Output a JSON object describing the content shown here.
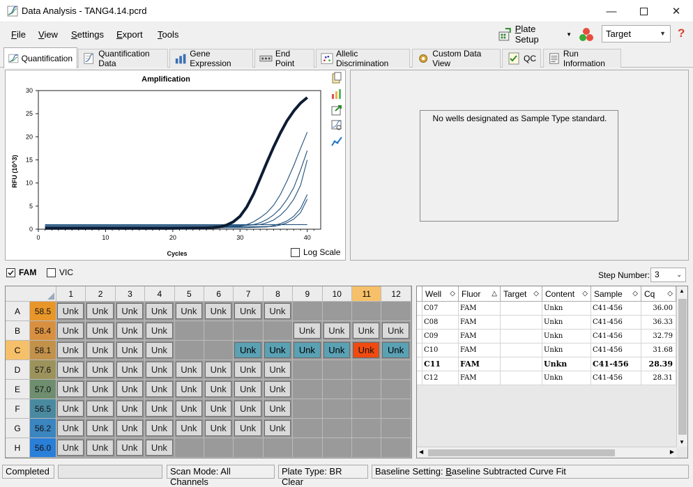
{
  "window": {
    "title": "Data Analysis - TANG4.14.pcrd"
  },
  "menu": [
    {
      "label": "File",
      "u": "F",
      "rest": "ile"
    },
    {
      "label": "View",
      "u": "V",
      "rest": "iew"
    },
    {
      "label": "Settings",
      "u": "S",
      "rest": "ettings"
    },
    {
      "label": "Export",
      "u": "E",
      "rest": "xport"
    },
    {
      "label": "Tools",
      "u": "T",
      "rest": "ools"
    }
  ],
  "toolbar": {
    "plate_setup_u": "P",
    "plate_setup_rest": "late Setup",
    "target_value": "Target",
    "help": "?"
  },
  "tabs": [
    "Quantification",
    "Quantification Data",
    "Gene Expression",
    "End Point",
    "Allelic Discrimination",
    "Custom Data View",
    "QC",
    "Run Information"
  ],
  "chart": {
    "title": "Amplification",
    "xlabel": "Cycles",
    "ylabel": "RFU (10^3)",
    "log_scale_label": "Log Scale"
  },
  "chart_data": {
    "type": "line",
    "title": "Amplification",
    "xlabel": "Cycles",
    "ylabel": "RFU (10^3)",
    "xlim": [
      0,
      42
    ],
    "ylim": [
      0,
      30
    ],
    "xticks": [
      0,
      10,
      20,
      30,
      40
    ],
    "yticks": [
      0,
      5,
      10,
      15,
      20,
      25,
      30
    ],
    "grid": true,
    "series": [
      {
        "x": [
          1,
          5,
          10,
          15,
          20,
          25,
          27,
          28,
          29,
          30,
          31,
          32,
          33,
          34,
          35,
          36,
          37,
          38,
          39,
          40
        ],
        "y": [
          0.2,
          0.2,
          0.2,
          0.2,
          0.2,
          0.3,
          0.5,
          0.9,
          1.6,
          2.8,
          4.8,
          7.6,
          11,
          14.5,
          17.8,
          20.8,
          23.5,
          25.6,
          27.3,
          28.5
        ],
        "highlight": true
      },
      {
        "x": [
          1,
          5,
          10,
          15,
          20,
          25,
          30,
          31,
          32,
          33,
          34,
          35,
          36,
          37,
          38,
          39,
          40
        ],
        "y": [
          0.4,
          0.4,
          0.4,
          0.4,
          0.4,
          0.4,
          0.6,
          1.0,
          1.6,
          2.5,
          3.6,
          5.2,
          7.5,
          10.5,
          13.8,
          17.5,
          21
        ]
      },
      {
        "x": [
          1,
          5,
          10,
          15,
          20,
          25,
          30,
          32,
          33,
          34,
          35,
          36,
          37,
          38,
          39,
          40
        ],
        "y": [
          0.6,
          0.6,
          0.6,
          0.6,
          0.6,
          0.6,
          0.7,
          1.0,
          1.4,
          2.1,
          3.1,
          4.5,
          6.5,
          9.0,
          12.8,
          17
        ]
      },
      {
        "x": [
          1,
          5,
          10,
          15,
          20,
          25,
          30,
          33,
          34,
          35,
          36,
          37,
          38,
          39,
          40
        ],
        "y": [
          0.8,
          0.8,
          0.8,
          0.8,
          0.8,
          0.8,
          0.8,
          1.0,
          1.4,
          2.0,
          3.0,
          4.5,
          6.5,
          9.5,
          15
        ]
      },
      {
        "x": [
          1,
          5,
          10,
          15,
          20,
          25,
          30,
          34,
          35,
          36,
          37,
          38,
          39,
          40
        ],
        "y": [
          0.3,
          0.3,
          0.3,
          0.3,
          0.3,
          0.3,
          0.3,
          0.5,
          0.8,
          1.2,
          1.8,
          2.8,
          4.5,
          7.5
        ]
      },
      {
        "x": [
          1,
          5,
          10,
          15,
          20,
          25,
          30,
          35,
          36,
          37,
          38,
          39,
          40
        ],
        "y": [
          0.5,
          0.5,
          0.5,
          0.5,
          0.5,
          0.5,
          0.5,
          0.6,
          0.9,
          1.4,
          2.2,
          3.6,
          6.5
        ]
      },
      {
        "x": [
          1,
          5,
          10,
          15,
          20,
          25,
          30,
          35,
          40
        ],
        "y": [
          1.0,
          1.0,
          1.0,
          1.0,
          1.0,
          1.0,
          1.0,
          1.0,
          1.0
        ]
      }
    ]
  },
  "right_panel": {
    "message": "No wells designated as Sample Type standard."
  },
  "fluor": {
    "fam": "FAM",
    "vic": "VIC",
    "step_label": "Step Number:",
    "step_value": "3"
  },
  "plate": {
    "cols": [
      "1",
      "2",
      "3",
      "4",
      "5",
      "6",
      "7",
      "8",
      "9",
      "10",
      "11",
      "12"
    ],
    "rows": [
      {
        "label": "A",
        "temp": "58.5",
        "color": "#e8962a",
        "wells": [
          1,
          1,
          1,
          1,
          1,
          1,
          1,
          1,
          0,
          0,
          0,
          0
        ]
      },
      {
        "label": "B",
        "temp": "58.4",
        "color": "#d89040",
        "wells": [
          1,
          1,
          1,
          1,
          0,
          0,
          0,
          0,
          1,
          1,
          1,
          1
        ]
      },
      {
        "label": "C",
        "temp": "58.1",
        "color": "#c2914a",
        "wells": [
          1,
          1,
          1,
          1,
          0,
          0,
          2,
          2,
          2,
          2,
          3,
          2
        ]
      },
      {
        "label": "D",
        "temp": "57.6",
        "color": "#9c935c",
        "wells": [
          1,
          1,
          1,
          1,
          1,
          1,
          1,
          1,
          0,
          0,
          0,
          0
        ]
      },
      {
        "label": "E",
        "temp": "57.0",
        "color": "#6f8e6f",
        "wells": [
          1,
          1,
          1,
          1,
          1,
          1,
          1,
          1,
          0,
          0,
          0,
          0
        ]
      },
      {
        "label": "F",
        "temp": "56.5",
        "color": "#4a8aa0",
        "wells": [
          1,
          1,
          1,
          1,
          1,
          1,
          1,
          1,
          0,
          0,
          0,
          0
        ]
      },
      {
        "label": "G",
        "temp": "56.2",
        "color": "#3b85c0",
        "wells": [
          1,
          1,
          1,
          1,
          1,
          1,
          1,
          1,
          0,
          0,
          0,
          0
        ]
      },
      {
        "label": "H",
        "temp": "56.0",
        "color": "#2a7fd8",
        "wells": [
          1,
          1,
          1,
          1,
          0,
          0,
          0,
          0,
          0,
          0,
          0,
          0
        ]
      }
    ],
    "well_label": "Unk",
    "selected_row": "C",
    "selected_col": "11"
  },
  "table": {
    "headers": [
      "Well",
      "Fluor",
      "Target",
      "Content",
      "Sample",
      "Cq"
    ],
    "rows": [
      [
        "C07",
        "FAM",
        "",
        "Unkn",
        "C41-456",
        "36.00"
      ],
      [
        "C08",
        "FAM",
        "",
        "Unkn",
        "C41-456",
        "36.33"
      ],
      [
        "C09",
        "FAM",
        "",
        "Unkn",
        "C41-456",
        "32.79"
      ],
      [
        "C10",
        "FAM",
        "",
        "Unkn",
        "C41-456",
        "31.68"
      ],
      [
        "C11",
        "FAM",
        "",
        "Unkn",
        "C41-456",
        "28.39"
      ],
      [
        "C12",
        "FAM",
        "",
        "Unkn",
        "C41-456",
        "28.31"
      ]
    ],
    "bold_row": 4
  },
  "status": {
    "state": "Completed",
    "scan_mode": "Scan Mode: All Channels",
    "plate_type": "Plate Type: BR Clear",
    "baseline_prefix": "Baseline Setting: ",
    "baseline_u": "B",
    "baseline_rest": "aseline Subtracted Curve Fit"
  },
  "colors": {
    "selected_well": "#5aa1b4",
    "current_well": "#f04a10",
    "curve": "#1f4f7a",
    "highlight_curve": "#0d1c33"
  }
}
